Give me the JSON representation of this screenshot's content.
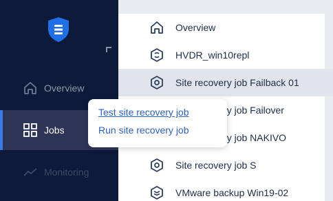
{
  "colors": {
    "sidebar_bg": "#0d1a3a",
    "sidebar_active_bg": "#2e3557",
    "accent": "#3b7be8",
    "list_bg": "#ffffff",
    "list_selected_bg": "#e1e4ea",
    "link": "#2d5fc4"
  },
  "sidebar": {
    "logo_icon": "shield-icon",
    "items": [
      {
        "label": "Overview",
        "icon": "home-icon",
        "active": false
      },
      {
        "label": "Jobs",
        "icon": "grid-icon",
        "active": true
      },
      {
        "label": "Monitoring",
        "icon": "chart-line-icon",
        "active": false
      }
    ]
  },
  "list": {
    "items": [
      {
        "label": "Overview",
        "icon": "home-icon"
      },
      {
        "label": "HVDR_win10repl",
        "icon": "replication-icon"
      },
      {
        "label": "Site recovery job Failback 01",
        "icon": "gear-icon",
        "selected": true
      },
      {
        "label": "Site recovery job Failover",
        "icon": "gear-icon"
      },
      {
        "label": "Site recovery job NAKIVO",
        "icon": "gear-icon"
      },
      {
        "label": "Site recovery job S",
        "icon": "gear-icon"
      },
      {
        "label": "VMware backup Win19-02",
        "icon": "backup-icon"
      }
    ]
  },
  "popup": {
    "items": [
      {
        "label": "Test site recovery job"
      },
      {
        "label": "Run site recovery job"
      }
    ]
  }
}
